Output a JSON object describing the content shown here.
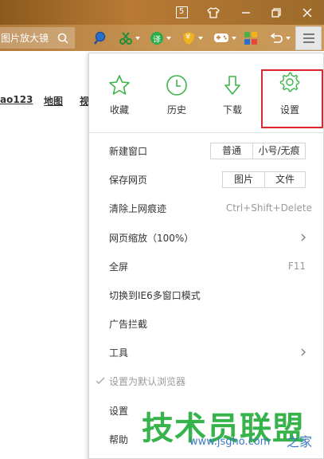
{
  "titlebar": {
    "tab_count": "5"
  },
  "toolbar": {
    "address_text": "图片放大镜",
    "translate_badge": "译",
    "security_badge": "¥"
  },
  "page": {
    "links": [
      "ao123",
      "地图",
      "视"
    ]
  },
  "menu": {
    "quick": [
      {
        "label": "收藏",
        "icon": "star-icon"
      },
      {
        "label": "历史",
        "icon": "clock-icon"
      },
      {
        "label": "下载",
        "icon": "download-arrow-icon"
      },
      {
        "label": "设置",
        "icon": "gear-icon"
      }
    ],
    "new_window": {
      "label": "新建窗口",
      "options": [
        "普通",
        "小号/无痕"
      ]
    },
    "save_page": {
      "label": "保存网页",
      "options": [
        "图片",
        "文件"
      ]
    },
    "clear_history": {
      "label": "清除上网痕迹",
      "shortcut": "Ctrl+Shift+Delete"
    },
    "zoom": {
      "label": "网页缩放（100%）"
    },
    "fullscreen": {
      "label": "全屏",
      "shortcut": "F11"
    },
    "ie6_mode": {
      "label": "切换到IE6多窗口模式"
    },
    "adblock": {
      "label": "广告拦截"
    },
    "tools": {
      "label": "工具"
    },
    "default_browser": {
      "label": "设置为默认浏览器"
    },
    "settings": {
      "label": "设置"
    },
    "help": {
      "label": "帮助"
    }
  },
  "watermark": {
    "main": "技术员联盟",
    "sub": "www.jsgho.com",
    "sub2": "之家"
  },
  "colors": {
    "accent_green": "#3bb54a",
    "highlight_red": "#d9262f",
    "watermark_green": "#36b34a",
    "watermark_blue": "#3a78c4"
  }
}
